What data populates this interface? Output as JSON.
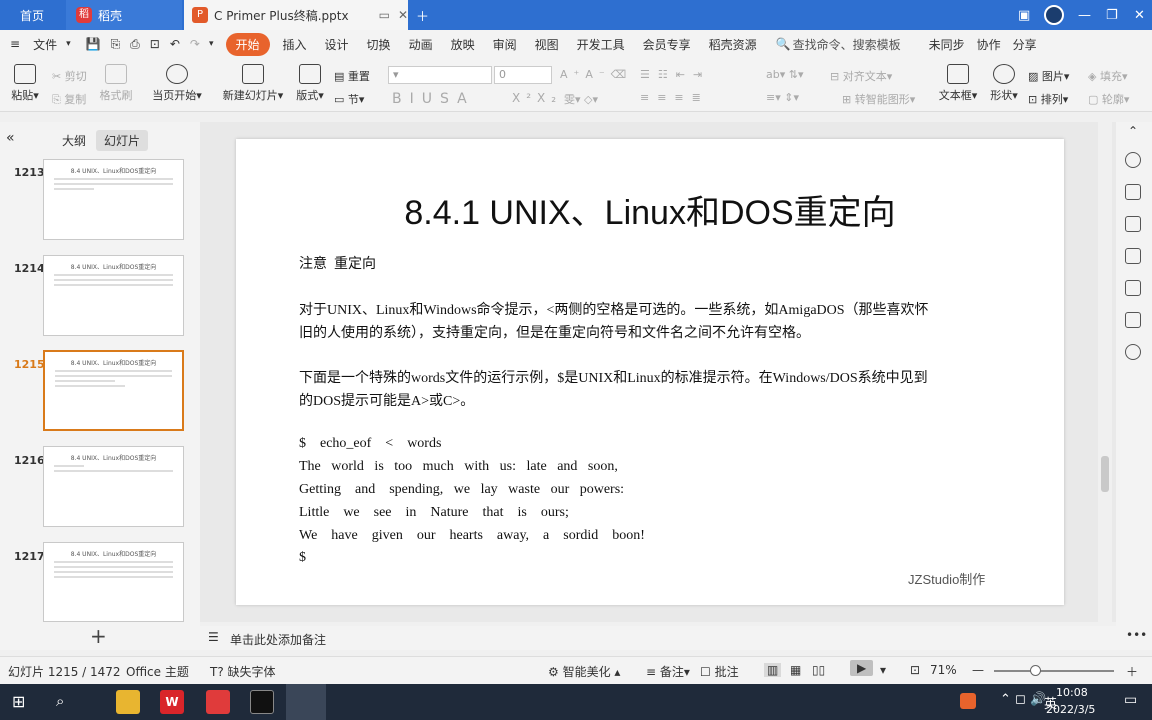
{
  "tabs": {
    "home": "首页",
    "docer": "稻壳",
    "document": "C Primer  Plus终稿.pptx"
  },
  "menu": {
    "file": "文件",
    "items": [
      "开始",
      "插入",
      "设计",
      "切换",
      "动画",
      "放映",
      "审阅",
      "视图",
      "开发工具",
      "会员专享",
      "稻壳资源"
    ],
    "search": "查找命令、搜索模板",
    "unsync": "未同步",
    "collab": "协作",
    "share": "分享"
  },
  "ribbon": {
    "paste": "粘贴",
    "cut": "剪切",
    "copy": "复制",
    "format_painter": "格式刷",
    "play_from_current": "当页开始",
    "new_slide": "新建幻灯片",
    "layout": "版式",
    "reset": "重置",
    "section": "节",
    "font_size": "0",
    "align_text": "对齐文本",
    "smart_shape": "转智能图形",
    "textbox": "文本框",
    "shape": "形状",
    "picture": "图片",
    "fill": "填充",
    "arrange": "排列",
    "outline": "轮廓"
  },
  "left_panel": {
    "outline_tab": "大纲",
    "slides_tab": "幻灯片",
    "thumbs": [
      {
        "num": "1213",
        "title": "8.4 UNIX、Linux和DOS重定向",
        "current": false
      },
      {
        "num": "1214",
        "title": "8.4 UNIX、Linux和DOS重定向",
        "current": false
      },
      {
        "num": "1215",
        "title": "8.4 UNIX、Linux和DOS重定向",
        "current": true
      },
      {
        "num": "1216",
        "title": "8.4 UNIX、Linux和DOS重定向",
        "current": false
      },
      {
        "num": "1217",
        "title": "8.4 UNIX、Linux和DOS重定向",
        "current": false
      }
    ],
    "add_slide": "+"
  },
  "slide": {
    "title": "8.4.1 UNIX、Linux和DOS重定向",
    "lines": [
      "注意  重定向",
      "对于UNIX、Linux和Windows命令提示，<两侧的空格是可选的。一些系统，如AmigaDOS（那些喜欢怀",
      "旧的人使用的系统），支持重定向，但是在重定向符号和文件名之间不允许有空格。",
      "下面是一个特殊的words文件的运行示例，$是UNIX和Linux的标准提示符。在Windows/DOS系统中见到",
      "的DOS提示可能是A>或C>。",
      "$    echo_eof    <    words",
      "The   world   is   too   much   with   us:   late   and   soon,",
      "Getting    and    spending,   we   lay   waste   our   powers:",
      "Little    we    see    in    Nature    that    is    ours;",
      "We    have    given    our    hearts    away,    a    sordid    boon!",
      "$"
    ],
    "credit": "JZStudio制作"
  },
  "notes_placeholder": "单击此处添加备注",
  "status": {
    "slide_info": "幻灯片 1215 / 1472",
    "theme": "Office 主题",
    "missing_font": "缺失字体",
    "beautify": "智能美化",
    "notes": "备注",
    "comments": "批注",
    "zoom": "71%"
  },
  "taskbar": {
    "time": "10:08",
    "date": "2022/3/5",
    "ime": "英"
  },
  "colors": {
    "tabbar": "#2e6fd0",
    "accent": "#e8632c",
    "current_slide": "#d97a1a"
  }
}
